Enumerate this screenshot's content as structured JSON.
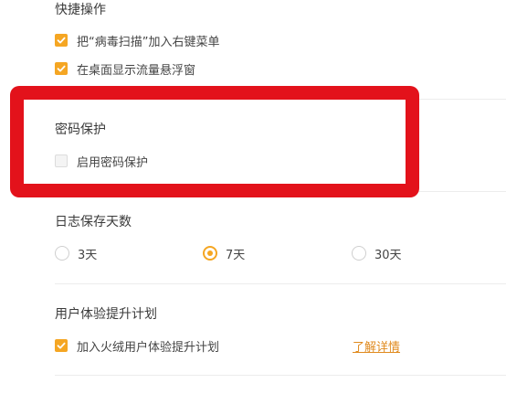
{
  "quick_actions": {
    "title": "快捷操作",
    "items": [
      {
        "label": "把“病毒扫描”加入右键菜单",
        "checked": true
      },
      {
        "label": "在桌面显示流量悬浮窗",
        "checked": true
      }
    ]
  },
  "password_protection": {
    "title": "密码保护",
    "items": [
      {
        "label": "启用密码保护",
        "checked": false
      }
    ]
  },
  "log_retention": {
    "title": "日志保存天数",
    "options": [
      {
        "label": "3天",
        "selected": false
      },
      {
        "label": "7天",
        "selected": true
      },
      {
        "label": "30天",
        "selected": false
      }
    ]
  },
  "ux_program": {
    "title": "用户体验提升计划",
    "item": {
      "label": "加入火绒用户体验提升计划",
      "checked": true
    },
    "link": "了解详情"
  },
  "colors": {
    "accent": "#f5a623",
    "highlight_border": "#e3121b",
    "link": "#e08a1e"
  }
}
